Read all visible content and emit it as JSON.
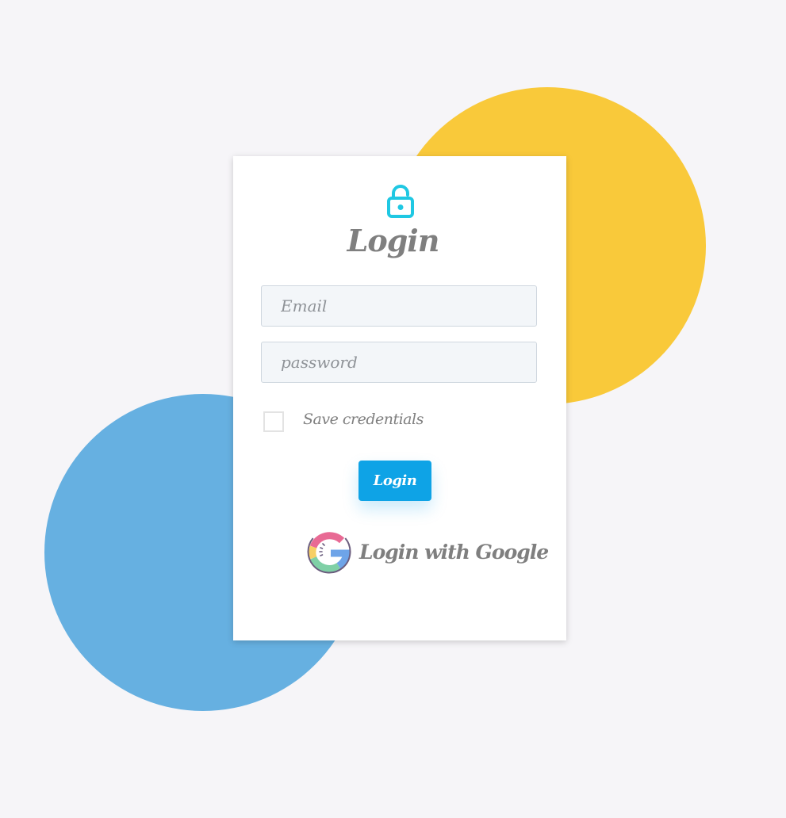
{
  "colors": {
    "background": "#f6f5f8",
    "circle_yellow": "#f9c93a",
    "circle_blue": "#66b0e1",
    "accent_lock": "#1fc8e3",
    "text_gray": "#7f7f7f",
    "button_bg": "#0ea3e6",
    "button_text": "#ffffff"
  },
  "card": {
    "icon": "lock-icon",
    "title": "Login"
  },
  "form": {
    "email": {
      "placeholder": "Email",
      "value": ""
    },
    "password": {
      "placeholder": "password",
      "value": ""
    },
    "save_credentials": {
      "label": "Save credentials",
      "checked": false
    },
    "submit_label": "Login"
  },
  "google": {
    "icon": "google-icon",
    "label": "Login with Google"
  }
}
